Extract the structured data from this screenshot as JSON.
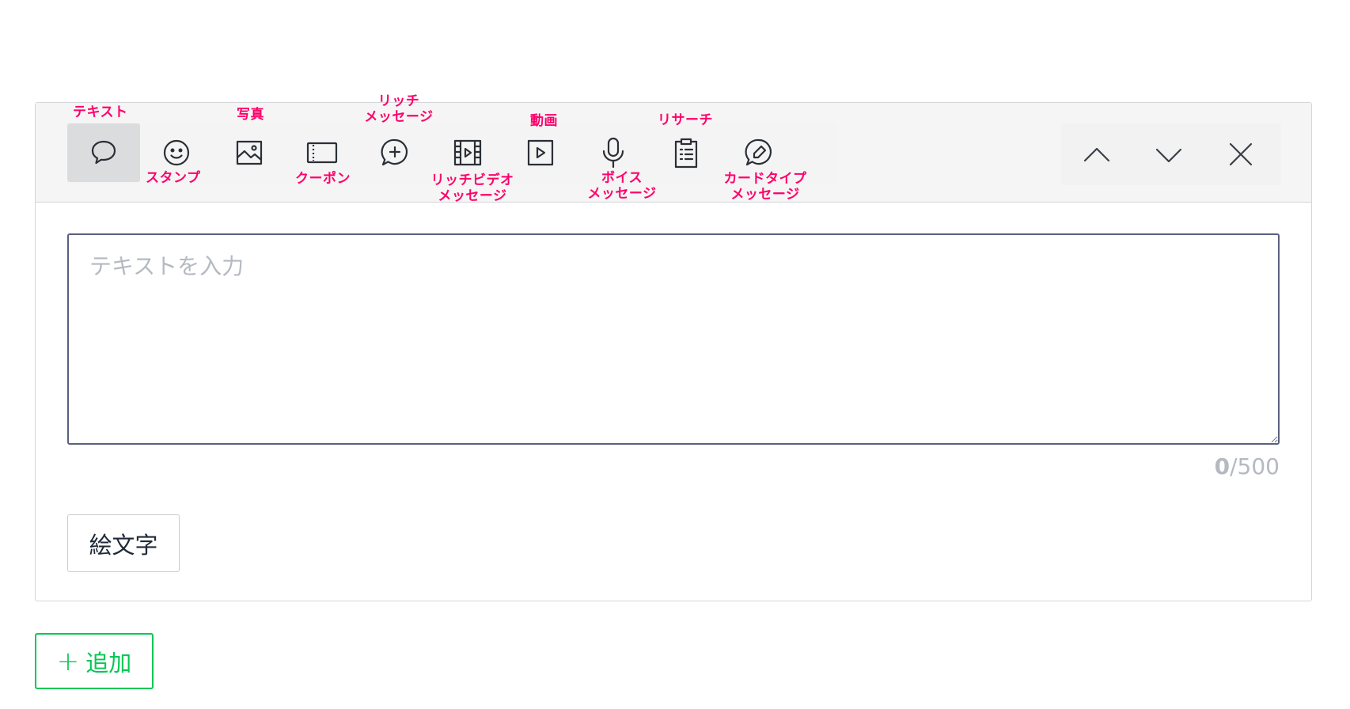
{
  "toolbar": {
    "tools": [
      {
        "icon": "speech-bubble-icon",
        "label": "テキスト",
        "active": true
      },
      {
        "icon": "smiley-icon",
        "label": "スタンプ"
      },
      {
        "icon": "image-icon",
        "label": "写真"
      },
      {
        "icon": "ticket-icon",
        "label": "クーポン"
      },
      {
        "icon": "plus-bubble-icon",
        "label_lines": [
          "リッチ",
          "メッセージ"
        ]
      },
      {
        "icon": "film-icon",
        "label_lines": [
          "リッチビデオ",
          "メッセージ"
        ]
      },
      {
        "icon": "play-icon",
        "label": "動画"
      },
      {
        "icon": "microphone-icon",
        "label_lines": [
          "ボイス",
          "メッセージ"
        ]
      },
      {
        "icon": "clipboard-list-icon",
        "label": "リサーチ"
      },
      {
        "icon": "pencil-bubble-icon",
        "label_lines": [
          "カードタイプ",
          "メッセージ"
        ]
      }
    ],
    "nav": [
      "chevron-up-icon",
      "chevron-down-icon",
      "close-icon"
    ]
  },
  "editor": {
    "placeholder": "テキストを入力",
    "value": "",
    "count_current": "0",
    "count_sep_max": "/500"
  },
  "emoji_button": {
    "label": "絵文字"
  },
  "add_button": {
    "label": "追加",
    "icon": "plus-icon"
  },
  "colors": {
    "annotation": "#ff006a",
    "accent_green": "#06c755",
    "border": "#d4d6da"
  }
}
